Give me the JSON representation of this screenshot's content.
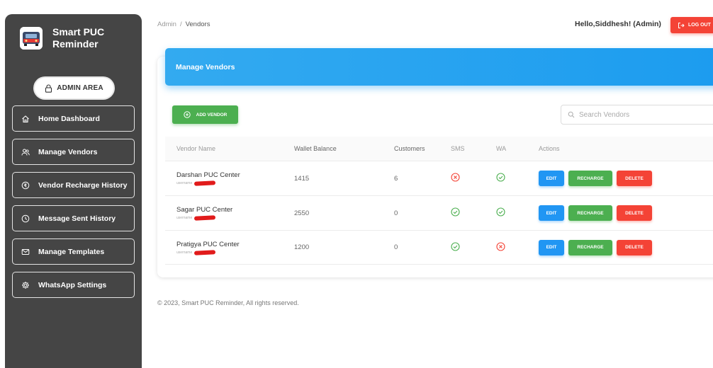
{
  "brand": {
    "title": "Smart PUC Reminder"
  },
  "sidebar": {
    "admin_area": "ADMIN AREA",
    "items": [
      {
        "label": "Home Dashboard",
        "icon": "home-icon"
      },
      {
        "label": "Manage Vendors",
        "icon": "users-icon"
      },
      {
        "label": "Vendor Recharge History",
        "icon": "history-coin-icon"
      },
      {
        "label": "Message Sent History",
        "icon": "clock-icon"
      },
      {
        "label": "Manage Templates",
        "icon": "mail-icon"
      },
      {
        "label": "WhatsApp Settings",
        "icon": "gear-icon"
      }
    ]
  },
  "header": {
    "breadcrumb_root": "Admin",
    "breadcrumb_sep": "/",
    "breadcrumb_current": "Vendors",
    "greeting": "Hello,Siddhesh! (Admin)",
    "logout_label": "LOG OUT"
  },
  "main": {
    "title": "Manage Vendors",
    "add_vendor_label": "ADD VENDOR",
    "search_placeholder": "Search Vendors",
    "columns": [
      "Vendor Name",
      "Wallet Balance",
      "Customers",
      "SMS",
      "WA",
      "Actions"
    ],
    "username_label": "username",
    "vendors": [
      {
        "name": "Darshan PUC Center",
        "balance": "1415",
        "customers": "6",
        "sms": "disabled",
        "wa": "enabled"
      },
      {
        "name": "Sagar PUC Center",
        "balance": "2550",
        "customers": "0",
        "sms": "enabled",
        "wa": "enabled"
      },
      {
        "name": "Pratigya PUC Center",
        "balance": "1200",
        "customers": "0",
        "sms": "enabled",
        "wa": "disabled"
      }
    ],
    "actions": {
      "edit": "EDIT",
      "recharge": "RECHARGE",
      "delete": "DELETE"
    }
  },
  "footer": {
    "text": "© 2023, Smart PUC Reminder, All rights reserved."
  },
  "colors": {
    "sidebar_bg": "#454545",
    "header_blue": "#1c9cef",
    "edit_blue": "#2196f3",
    "success_green": "#4caf50",
    "danger_red": "#f44336"
  }
}
